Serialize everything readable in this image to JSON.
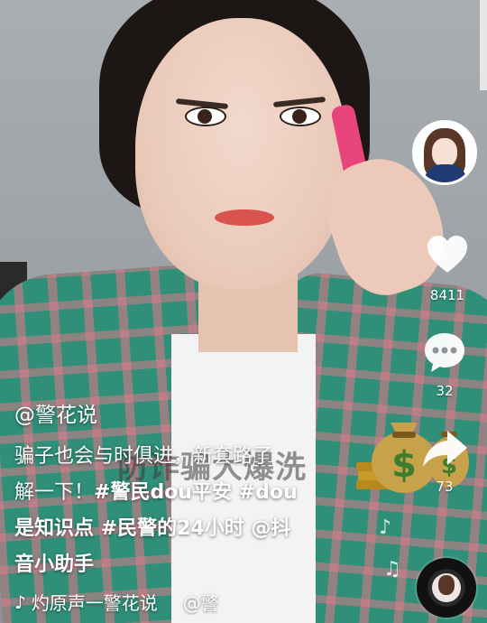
{
  "caption": {
    "author": "@警花说",
    "line1": "骗子也会与时俱进，新套路了",
    "line2_text": "解一下！",
    "tag1": "#警民dou平安",
    "tag2": " #dou",
    "line3_text": "是知识点",
    "tag3": " #民警的24小时",
    "mention": " @抖",
    "line4": "音小助手"
  },
  "overlay_watermark": "防诈骗大爆洗",
  "music": {
    "icon": "music-note-icon",
    "text": "灼原声一警花说",
    "mention": "@警"
  },
  "actions": {
    "likes": "8411",
    "comments": "32",
    "shares": "73"
  },
  "icons": [
    "heart-icon",
    "comment-icon",
    "share-icon",
    "money-bag-sticker",
    "music-disc"
  ],
  "colors": {
    "text": "#ffffff",
    "shirt": "#2f8f78",
    "phone": "#e8457c"
  }
}
